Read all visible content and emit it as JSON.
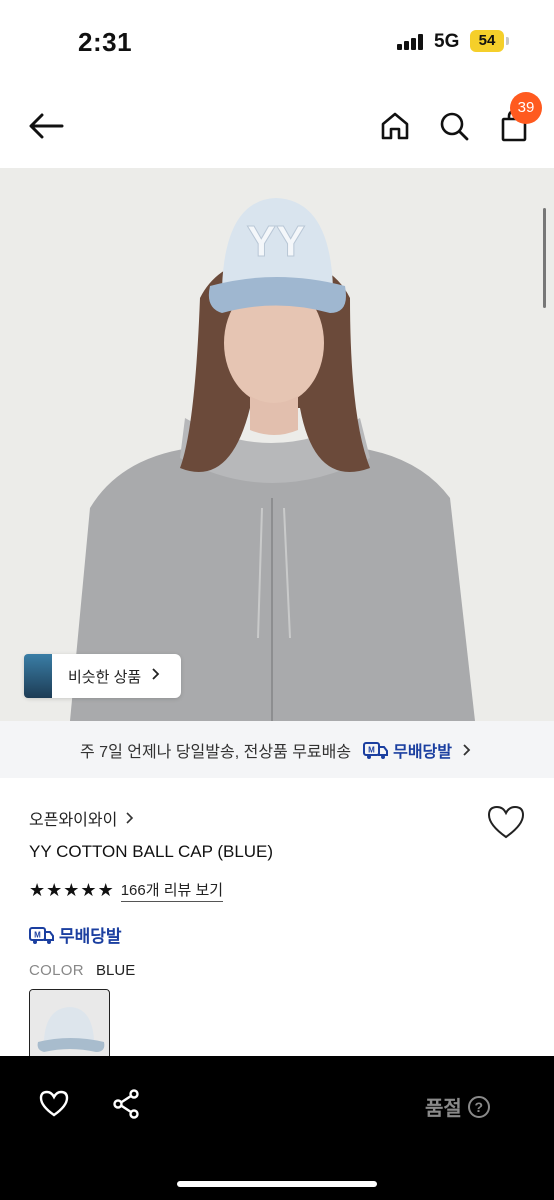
{
  "status_bar": {
    "time": "2:31",
    "network": "5G",
    "battery": "54"
  },
  "nav": {
    "back_icon": "arrow-left-icon",
    "home_icon": "home-icon",
    "search_icon": "search-icon",
    "cart_icon": "shopping-bag-icon",
    "cart_count": "39"
  },
  "hero": {
    "similar_button_label": "비슷한 상품"
  },
  "shipping_banner": {
    "text": "주 7일 언제나 당일발송, 전상품 무료배송",
    "badge_label": "무배당발"
  },
  "product": {
    "brand": "오픈와이와이",
    "name": "YY COTTON BALL CAP (BLUE)",
    "rating_stars": 5,
    "review_link": "166개 리뷰 보기",
    "free_shipping_label": "무배당발",
    "color_key": "COLOR",
    "color_value": "BLUE"
  },
  "bottom_bar": {
    "status_label": "품절",
    "help_icon_text": "?"
  },
  "colors": {
    "accent_orange": "#ff5a1f",
    "shipping_blue": "#1b3fa0",
    "battery_yellow": "#f5cf2a"
  }
}
